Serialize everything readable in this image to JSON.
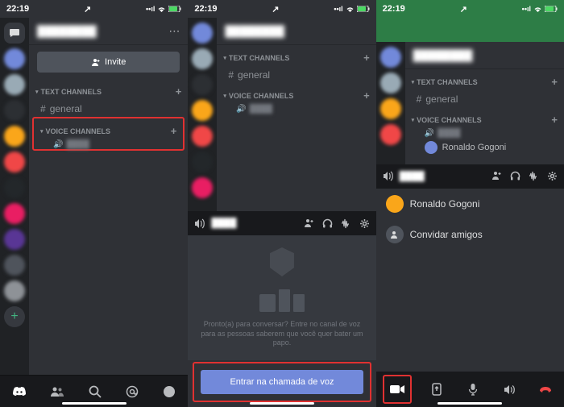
{
  "time": "22:19",
  "carrier_arrow": "↗",
  "battery_status": "􀋦",
  "server": {
    "name_blurred": "████████",
    "more": "⋯"
  },
  "invite_label": "Invite",
  "categories": {
    "text": {
      "label": "TEXT CHANNELS"
    },
    "voice": {
      "label": "VOICE CHANNELS"
    }
  },
  "channels": {
    "general": "general",
    "voice_sub_blurred": "████"
  },
  "voice_panel": {
    "channel_name_blurred": "████",
    "prompt": "Pronto(a) para conversar? Entre no canal de voz para as pessoas saberem que você quer bater um papo.",
    "join_label": "Entrar na chamada de voz"
  },
  "members": {
    "ronaldo": "Ronaldo Gogoni",
    "invite": "Convidar amigos"
  },
  "toolbar_icons": {
    "invite_user": "person-add",
    "headphones": "headphones",
    "noise": "noise-suppression",
    "settings": "gear"
  }
}
